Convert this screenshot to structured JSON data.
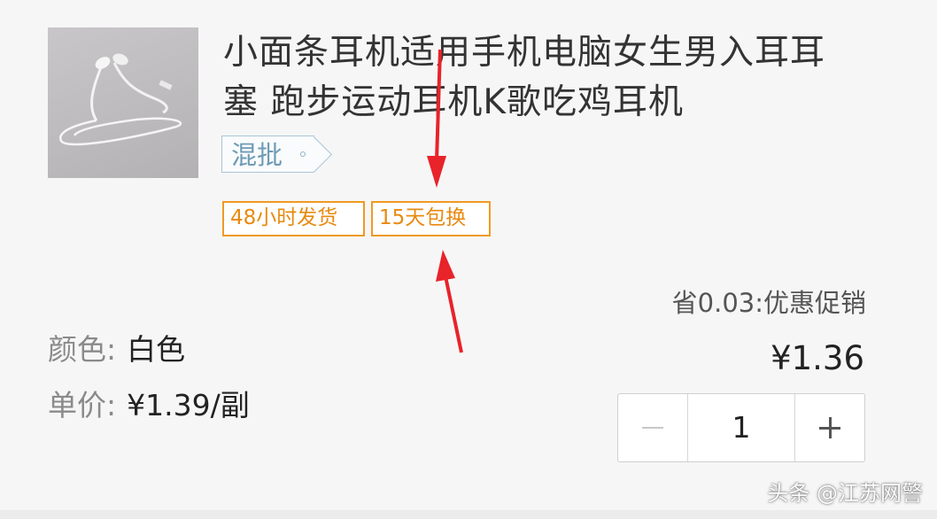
{
  "product": {
    "image": "earphones-product-image",
    "title": "小面条耳机适用手机电脑女生男入耳耳塞 跑步运动耳机K歌吃鸡耳机",
    "title_line1": "小面条耳机适用手机电脑女生男入耳耳",
    "title_line2": "塞 跑步运动耳机K歌吃鸡耳机",
    "wholesale_tag": "混批"
  },
  "services": [
    {
      "label": "48小时发货"
    },
    {
      "label": "15天包换"
    }
  ],
  "promotion": {
    "text": "省0.03:优惠促销",
    "icon": "chevron-down-icon"
  },
  "spec": {
    "color_label": "颜色:",
    "color_value": "白色",
    "unit_price_label": "单价:",
    "unit_price_value": "¥1.39/副"
  },
  "price": "¥1.36",
  "quantity": {
    "value": "1",
    "minus_icon": "minus-icon",
    "plus_icon": "plus-icon"
  },
  "watermark": "头条 @江苏网警",
  "colors": {
    "service_tag": "#f09a24",
    "wholesale_tag": "#6e9bb5",
    "annotation_arrow": "#e8232a"
  }
}
